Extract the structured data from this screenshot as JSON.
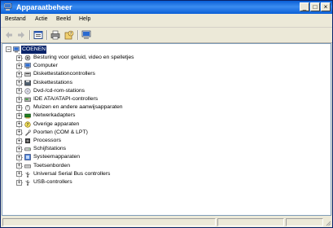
{
  "window": {
    "title": "Apparaatbeheer",
    "minimize": "_",
    "maximize": "□",
    "close": "×"
  },
  "menu": [
    "Bestand",
    "Actie",
    "Beeld",
    "Help"
  ],
  "toolbar": {
    "buttons": [
      "back-arrow-icon",
      "forward-arrow-icon",
      "properties-icon",
      "print-icon",
      "help-icon",
      "computer-view-icon"
    ]
  },
  "tree": {
    "root": {
      "label": "COENEN",
      "expander": "−"
    },
    "items": [
      {
        "label": "Besturing voor geluid, video en spelletjes",
        "icon": "sound-icon",
        "expander": "+"
      },
      {
        "label": "Computer",
        "icon": "computer-icon",
        "expander": "+"
      },
      {
        "label": "Diskettestationcontrollers",
        "icon": "floppy-controller-icon",
        "expander": "+"
      },
      {
        "label": "Diskettestations",
        "icon": "floppy-drive-icon",
        "expander": "+"
      },
      {
        "label": "Dvd-/cd-rom-stations",
        "icon": "cdrom-icon",
        "expander": "+"
      },
      {
        "label": "IDE ATA/ATAPI-controllers",
        "icon": "ide-controller-icon",
        "expander": "+"
      },
      {
        "label": "Muizen en andere aanwijsapparaten",
        "icon": "mouse-icon",
        "expander": "+"
      },
      {
        "label": "Netwerkadapters",
        "icon": "network-adapter-icon",
        "expander": "+"
      },
      {
        "label": "Overige apparaten",
        "icon": "unknown-device-icon",
        "expander": "+"
      },
      {
        "label": "Poorten (COM & LPT)",
        "icon": "port-icon",
        "expander": "+"
      },
      {
        "label": "Processors",
        "icon": "processor-icon",
        "expander": "+"
      },
      {
        "label": "Schijfstations",
        "icon": "disk-drive-icon",
        "expander": "+"
      },
      {
        "label": "Systeemapparaten",
        "icon": "system-device-icon",
        "expander": "+"
      },
      {
        "label": "Toetsenborden",
        "icon": "keyboard-icon",
        "expander": "+"
      },
      {
        "label": "Universal Serial Bus controllers",
        "icon": "usb-icon",
        "expander": "+"
      },
      {
        "label": "USB-controllers",
        "icon": "usb-icon",
        "expander": "+"
      }
    ]
  },
  "colors": {
    "title_bar": "#0A5FD7",
    "chrome": "#ECE9D8",
    "selection": "#0A246A"
  }
}
